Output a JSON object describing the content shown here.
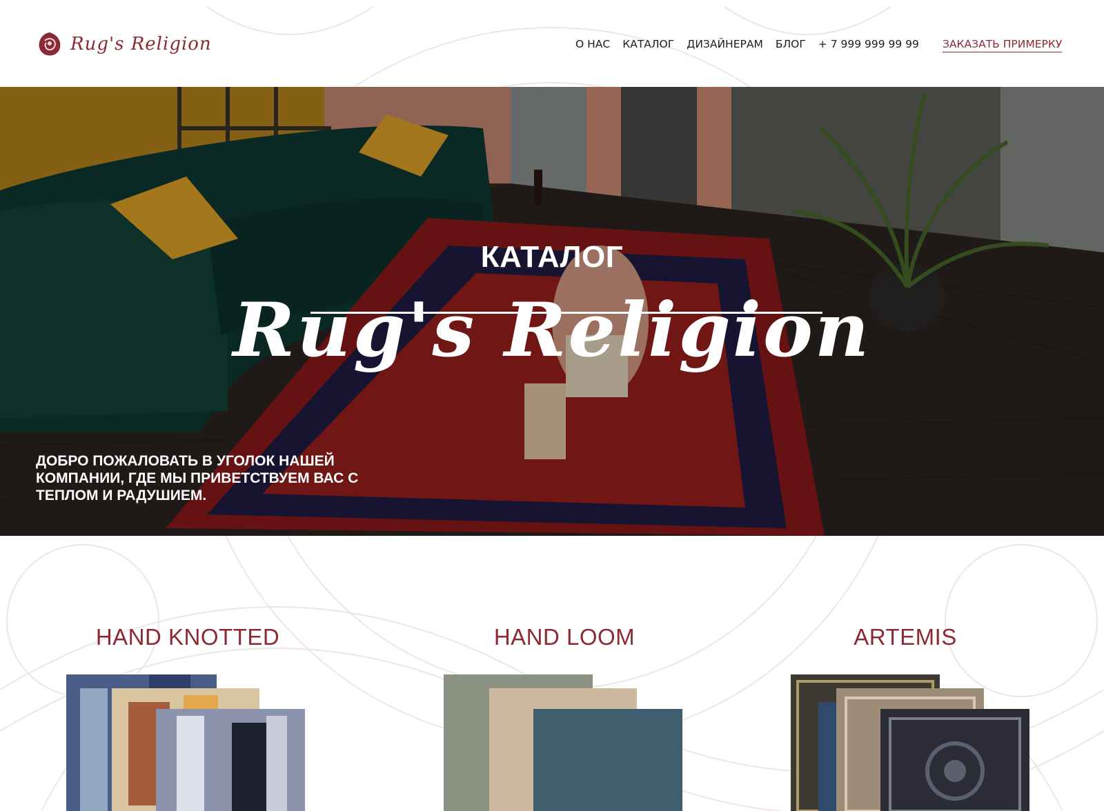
{
  "header": {
    "logo_text": "Rug's Religion",
    "nav": [
      "О НАС",
      "КАТАЛОГ",
      "ДИЗАЙНЕРАМ",
      "БЛОГ"
    ],
    "phone": "+ 7 999 999 99 99",
    "cta_label": "ЗАКАЗАТЬ ПРИМЕРКУ"
  },
  "hero": {
    "kicker": "КАТАЛОГ",
    "title": "Rug's Religion",
    "welcome": "ДОБРО ПОЖАЛОВАТЬ В УГОЛОК НАШЕЙ КОМПАНИИ, ГДЕ МЫ ПРИВЕТСТВУЕМ ВАС С ТЕПЛОМ И РАДУШИЕМ."
  },
  "catalog": {
    "categories": [
      {
        "name": "HAND KNOTTED"
      },
      {
        "name": "HAND LOOM"
      },
      {
        "name": "ARTEMIS"
      }
    ]
  },
  "colors": {
    "brand": "#8b2a35",
    "text": "#1c1c1c",
    "ornament": "#eee3e5"
  }
}
